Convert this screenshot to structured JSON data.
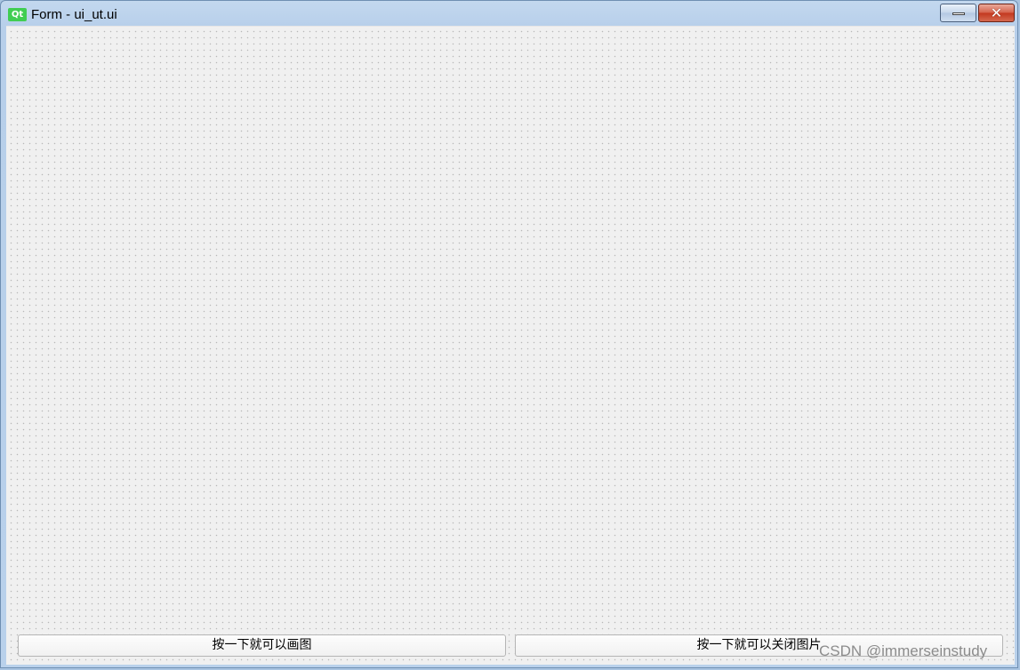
{
  "window": {
    "app_icon_text": "Qt",
    "title": "Form - ui_ut.ui",
    "minimize_icon": "minimize-icon",
    "close_icon": "close-icon"
  },
  "form": {
    "buttons": [
      {
        "label": "按一下就可以画图"
      },
      {
        "label": "按一下就可以关闭图片"
      }
    ]
  },
  "watermark": "CSDN @immerseinstudy",
  "colors": {
    "qt_icon": "#41cd52",
    "close_button": "#c3371e",
    "form_background": "#f0f0f0"
  }
}
